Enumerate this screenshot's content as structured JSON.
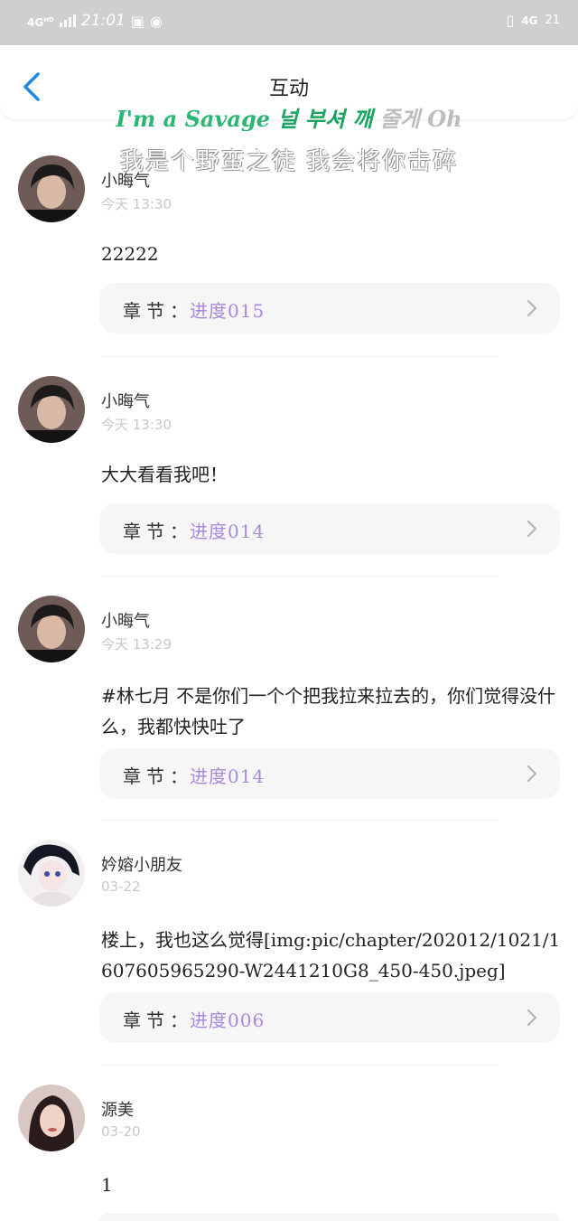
{
  "status_bar": {
    "network": "4G",
    "network_hd": "HD",
    "time": "21:01",
    "right_network": "4G",
    "battery": "21"
  },
  "header": {
    "title": "互动"
  },
  "overlay": {
    "lyric_part1": "I'm a Savage ",
    "lyric_part2": "널 부셔 깨",
    "lyric_part3": " 줄게 Oh",
    "translation": "我是个野蛮之徒 我会将你击碎"
  },
  "comments": [
    {
      "name": "小晦气",
      "time": "今天 13:30",
      "content": "22222",
      "chapter_label": "章节：",
      "chapter_value": "进度015",
      "avatar": "avatar-dark-hair"
    },
    {
      "name": "小晦气",
      "time": "今天 13:30",
      "content": "大大看看我吧！",
      "chapter_label": "章节：",
      "chapter_value": "进度014",
      "avatar": "avatar-dark-hair"
    },
    {
      "name": "小晦气",
      "time": "今天 13:29",
      "content": "#林七月 不是你们一个个把我拉来拉去的，你们觉得没什么，我都快快吐了",
      "chapter_label": "章节：",
      "chapter_value": "进度014",
      "avatar": "avatar-dark-hair"
    },
    {
      "name": "妗嫆小朋友",
      "time": "03-22",
      "content": "楼上，我也这么觉得[img:pic/chapter/202012/1021/1607605965290-W2441210G8_450-450.jpeg]",
      "chapter_label": "章节：",
      "chapter_value": "进度006",
      "avatar": "avatar-anime-girl"
    },
    {
      "name": "源美",
      "time": "03-20",
      "content": "1",
      "avatar": "avatar-woman"
    }
  ],
  "colors": {
    "accent_blue": "#1e88e5",
    "chapter_purple": "#a98ad9",
    "status_bar_bg": "#cfcfcf"
  }
}
